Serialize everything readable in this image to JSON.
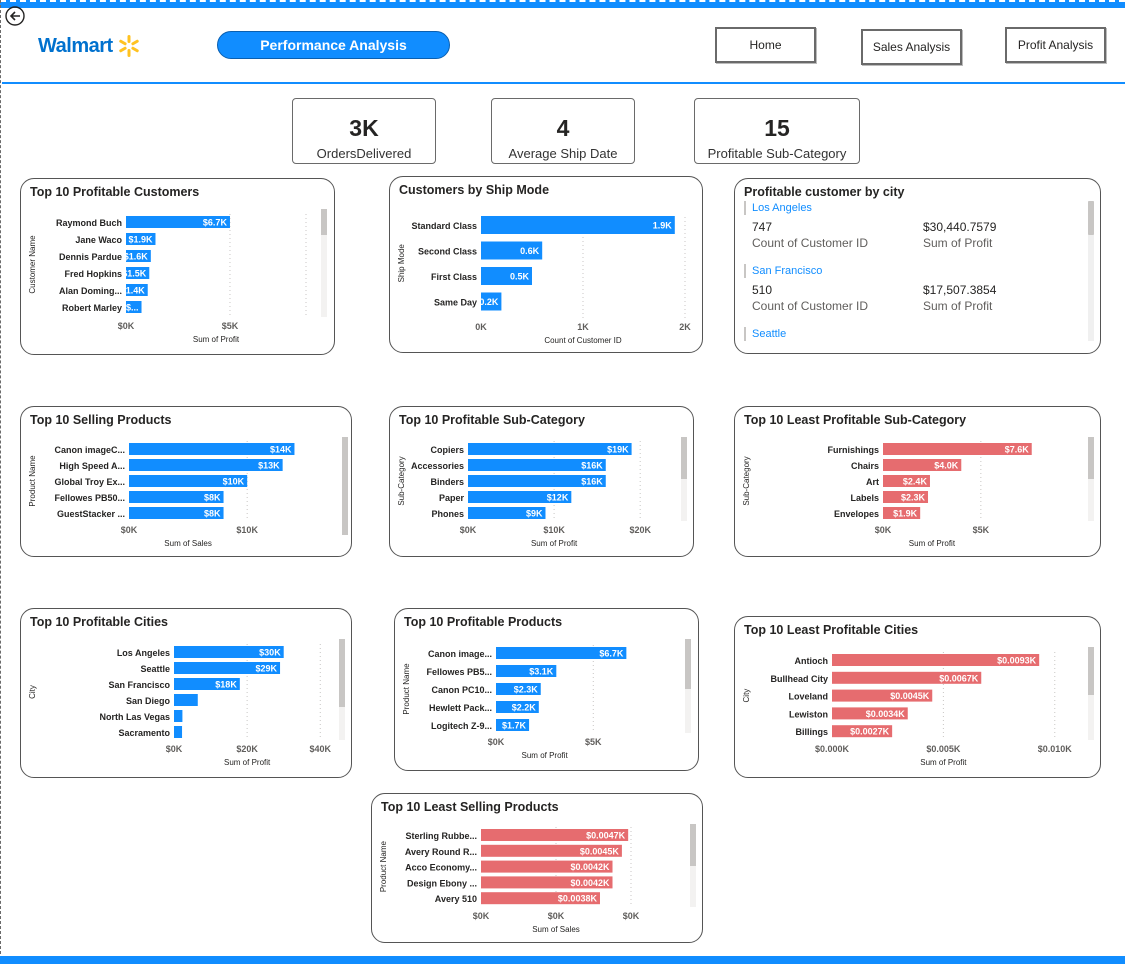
{
  "header": {
    "logo_text": "Walmart",
    "title_button": "Performance Analysis",
    "nav": [
      {
        "label": "Home"
      },
      {
        "label": "Sales Analysis"
      },
      {
        "label": "Profit Analysis"
      }
    ],
    "brand_color": "#0071ce",
    "accent_color": "#ffc220"
  },
  "kpis": [
    {
      "value": "3K",
      "label": "OrdersDelivered"
    },
    {
      "value": "4",
      "label": "Average Ship Date"
    },
    {
      "value": "15",
      "label": "Profitable Sub-Category"
    }
  ],
  "city_card": {
    "title": "Profitable customer by city",
    "entries": [
      {
        "city": "Los Angeles",
        "count": "747",
        "count_label": "Count of Customer ID",
        "profit": "$30,440.7579",
        "profit_label": "Sum of Profit"
      },
      {
        "city": "San Francisco",
        "count": "510",
        "count_label": "Count of Customer ID",
        "profit": "$17,507.3854",
        "profit_label": "Sum of Profit"
      },
      {
        "city": "Seattle",
        "count": "",
        "count_label": "",
        "profit": "",
        "profit_label": ""
      }
    ]
  },
  "charts": {
    "profitable_customers": {
      "title": "Top 10 Profitable Customers",
      "xlabel": "Sum of Profit",
      "ylabel": "Customer Name",
      "xticks": [
        "$0K",
        "$5K"
      ],
      "categories": [
        "Raymond Buch",
        "Jane Waco",
        "Dennis Pardue",
        "Fred Hopkins",
        "Alan Doming...",
        "Robert Marley"
      ],
      "values": [
        6.7,
        1.9,
        1.6,
        1.5,
        1.4,
        1.0
      ],
      "labels": [
        "$6.7K",
        "$1.9K",
        "$1.6K",
        "$1.5K",
        "$1.4K",
        "$..."
      ],
      "color": "#118dff"
    },
    "ship_mode": {
      "title": "Customers by Ship Mode",
      "xlabel": "Count of Customer ID",
      "ylabel": "Ship Mode",
      "xticks": [
        "0K",
        "1K",
        "2K"
      ],
      "categories": [
        "Standard Class",
        "Second Class",
        "First Class",
        "Same Day"
      ],
      "values": [
        1.9,
        0.6,
        0.5,
        0.2
      ],
      "labels": [
        "1.9K",
        "0.6K",
        "0.5K",
        "0.2K"
      ],
      "color": "#118dff"
    },
    "selling_products": {
      "title": "Top 10 Selling Products",
      "xlabel": "Sum of Sales",
      "ylabel": "Product Name",
      "xticks": [
        "$0K",
        "$10K"
      ],
      "categories": [
        "Canon imageC...",
        "High Speed A...",
        "Global Troy Ex...",
        "Fellowes PB50...",
        "GuestStacker ..."
      ],
      "values": [
        14,
        13,
        10,
        8,
        8
      ],
      "labels": [
        "$14K",
        "$13K",
        "$10K",
        "$8K",
        "$8K"
      ],
      "color": "#118dff"
    },
    "profitable_subcat": {
      "title": "Top 10 Profitable Sub-Category",
      "xlabel": "Sum of Profit",
      "ylabel": "Sub-Category",
      "xticks": [
        "$0K",
        "$10K",
        "$20K"
      ],
      "categories": [
        "Copiers",
        "Accessories",
        "Binders",
        "Paper",
        "Phones"
      ],
      "values": [
        19,
        16,
        16,
        12,
        9
      ],
      "labels": [
        "$19K",
        "$16K",
        "$16K",
        "$12K",
        "$9K"
      ],
      "color": "#118dff"
    },
    "least_profitable_subcat": {
      "title": "Top 10 Least Profitable Sub-Category",
      "xlabel": "Sum of Profit",
      "ylabel": "Sub-Category",
      "xticks": [
        "$0K",
        "$5K"
      ],
      "categories": [
        "Furnishings",
        "Chairs",
        "Art",
        "Labels",
        "Envelopes"
      ],
      "values": [
        7.6,
        4.0,
        2.4,
        2.3,
        1.9
      ],
      "labels": [
        "$7.6K",
        "$4.0K",
        "$2.4K",
        "$2.3K",
        "$1.9K"
      ],
      "color": "#e66c6f"
    },
    "profitable_cities": {
      "title": "Top 10 Profitable Cities",
      "xlabel": "Sum of Profit",
      "ylabel": "City",
      "xticks": [
        "$0K",
        "$20K",
        "$40K"
      ],
      "categories": [
        "Los Angeles",
        "Seattle",
        "San Francisco",
        "San Diego",
        "North Las Vegas",
        "Sacramento"
      ],
      "values": [
        30,
        29,
        18,
        6.5,
        2.3,
        2.2
      ],
      "labels": [
        "$30K",
        "$29K",
        "$18K",
        "",
        "",
        ""
      ],
      "color": "#118dff"
    },
    "profitable_products": {
      "title": "Top 10 Profitable Products",
      "xlabel": "Sum of Profit",
      "ylabel": "Product Name",
      "xticks": [
        "$0K",
        "$5K"
      ],
      "categories": [
        "Canon image...",
        "Fellowes PB5...",
        "Canon PC10...",
        "Hewlett Pack...",
        "Logitech Z-9..."
      ],
      "values": [
        6.7,
        3.1,
        2.3,
        2.2,
        1.7
      ],
      "labels": [
        "$6.7K",
        "$3.1K",
        "$2.3K",
        "$2.2K",
        "$1.7K"
      ],
      "color": "#118dff"
    },
    "least_profitable_cities": {
      "title": "Top 10 Least Profitable Cities",
      "xlabel": "Sum of Profit",
      "ylabel": "City",
      "xticks": [
        "$0.000K",
        "$0.005K",
        "$0.010K"
      ],
      "categories": [
        "Antioch",
        "Bullhead City",
        "Loveland",
        "Lewiston",
        "Billings"
      ],
      "values": [
        0.0093,
        0.0067,
        0.0045,
        0.0034,
        0.0027
      ],
      "labels": [
        "$0.0093K",
        "$0.0067K",
        "$0.0045K",
        "$0.0034K",
        "$0.0027K"
      ],
      "color": "#e66c6f"
    },
    "least_selling_products": {
      "title": "Top 10 Least Selling Products",
      "xlabel": "Sum of Sales",
      "ylabel": "Product Name",
      "xticks": [
        "$0K",
        "$0K",
        "$0K"
      ],
      "categories": [
        "Sterling Rubbe...",
        "Avery Round R...",
        "Acco Economy...",
        "Design Ebony ...",
        "Avery 510"
      ],
      "values": [
        0.0047,
        0.0045,
        0.0042,
        0.0042,
        0.0038
      ],
      "labels": [
        "$0.0047K",
        "$0.0045K",
        "$0.0042K",
        "$0.0042K",
        "$0.0038K"
      ],
      "color": "#e66c6f"
    }
  }
}
